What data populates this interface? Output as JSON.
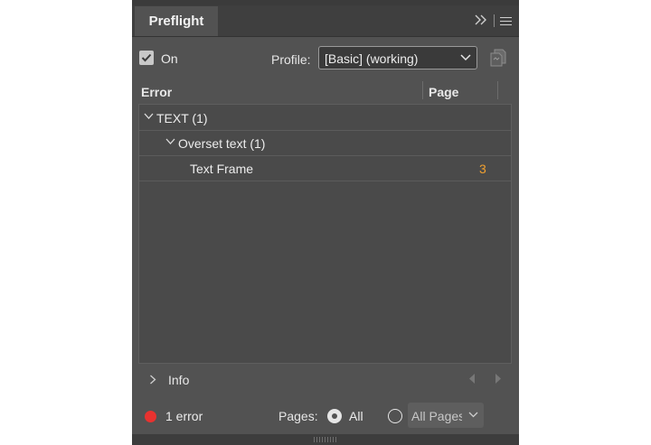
{
  "panel": {
    "tab_title": "Preflight",
    "collapse_icon": "double-chevron-right-icon",
    "menu_icon": "hamburger-menu-icon"
  },
  "options": {
    "on_checked": true,
    "on_label": "On",
    "profile_label": "Profile:",
    "profile_value": "[Basic] (working)",
    "define_profiles_icon": "define-profiles-icon"
  },
  "columns": {
    "error": "Error",
    "page": "Page"
  },
  "errors": [
    {
      "label": "TEXT (1)",
      "level": 0,
      "expanded": true,
      "page": ""
    },
    {
      "label": "Overset text (1)",
      "level": 1,
      "expanded": true,
      "page": ""
    },
    {
      "label": "Text Frame",
      "level": 2,
      "expanded": null,
      "page": "3"
    }
  ],
  "info": {
    "label": "Info",
    "expanded": false
  },
  "status": {
    "error_text": "1 error",
    "error_color": "#e8322f",
    "pages_label": "Pages:",
    "all_label": "All",
    "all_selected": true,
    "range_value": "All Pages"
  },
  "colors": {
    "panel_bg": "#525252",
    "page_number": "#f0a030"
  }
}
